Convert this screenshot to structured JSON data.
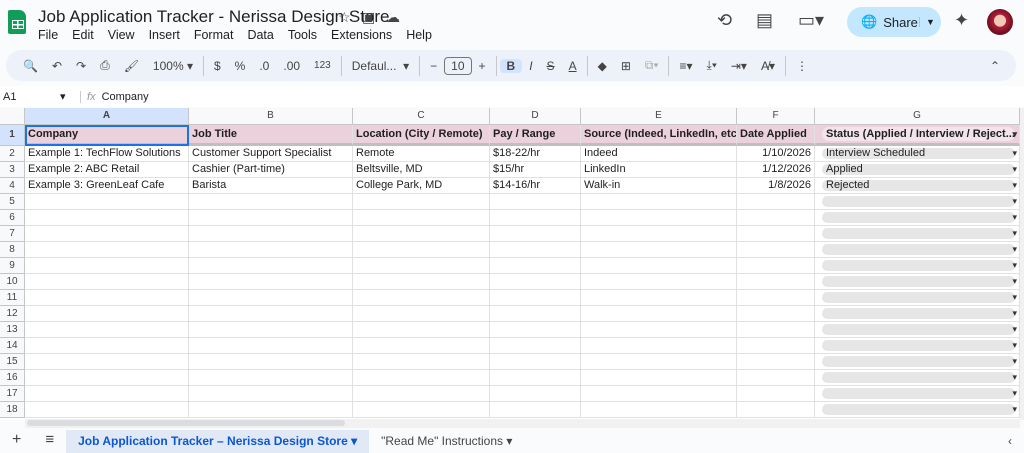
{
  "title": "Job Application Tracker - Nerissa Design Store",
  "menu": [
    "File",
    "Edit",
    "View",
    "Insert",
    "Format",
    "Data",
    "Tools",
    "Extensions",
    "Help"
  ],
  "share_label": "Share",
  "toolbar": {
    "zoom": "100%",
    "currency": "$",
    "percent": "%",
    "dec_less": ".0",
    "dec_more": ".00",
    "format_num": "123",
    "font": "Defaul...",
    "font_size": "10",
    "bold": "B"
  },
  "formula_bar": {
    "cell_ref": "A1",
    "fx": "fx",
    "value": "Company"
  },
  "columns": [
    "A",
    "B",
    "C",
    "D",
    "E",
    "F",
    "G"
  ],
  "headers": [
    "Company",
    "Job Title",
    "Location (City / Remote)",
    "Pay / Range",
    "Source (Indeed, LinkedIn, etc.)",
    "Date Applied",
    "Status (Applied / Interview / Reject..."
  ],
  "rows": [
    [
      "Example 1:  TechFlow Solutions",
      "Customer Support Specialist",
      "Remote",
      "$18-22/hr",
      "Indeed",
      "1/10/2026",
      "Interview Scheduled"
    ],
    [
      "Example 2:  ABC Retail",
      "Cashier (Part-time)",
      "Beltsville, MD",
      "$15/hr",
      "LinkedIn",
      "1/12/2026",
      "Applied"
    ],
    [
      "Example 3:  GreenLeaf Cafe",
      "Barista",
      "College Park, MD",
      "$14-16/hr",
      "Walk-in",
      "1/8/2026",
      "Rejected"
    ]
  ],
  "row_numbers": [
    "1",
    "2",
    "3",
    "4",
    "5",
    "6",
    "7",
    "8",
    "9",
    "10",
    "11",
    "12",
    "13",
    "14",
    "15",
    "16",
    "17",
    "18"
  ],
  "sheets": [
    {
      "label": "Job Application Tracker – Nerissa Design Store",
      "active": true
    },
    {
      "label": "\"Read Me\" Instructions",
      "active": false
    }
  ],
  "colors": {
    "header_fill": "#ead1dc",
    "selection": "#d3e3fd",
    "share": "#c2e7ff"
  }
}
